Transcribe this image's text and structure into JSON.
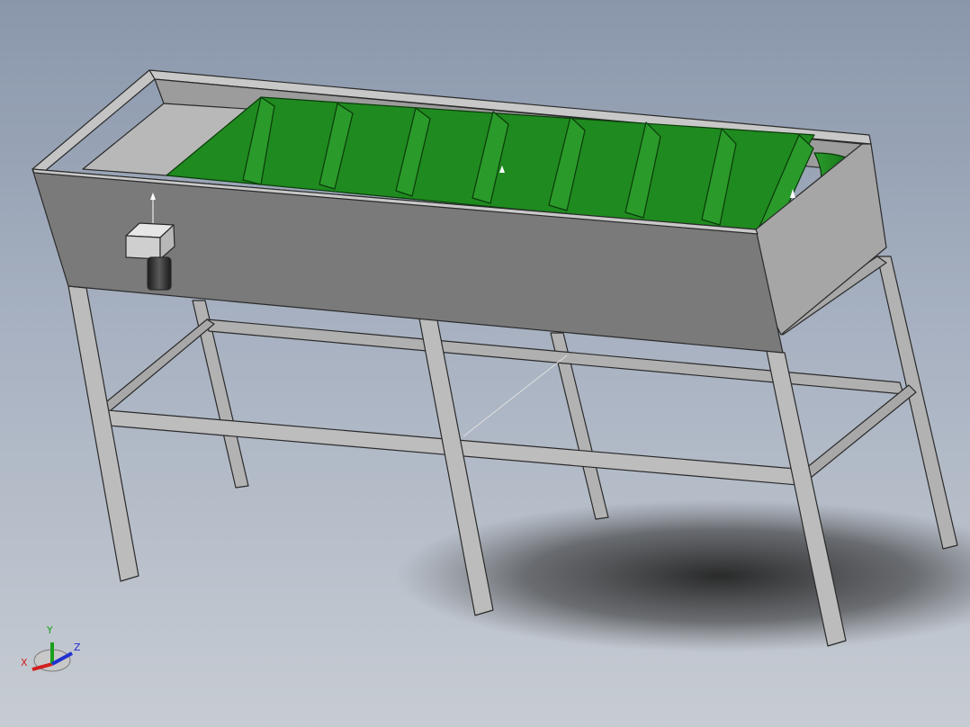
{
  "viewport": {
    "background_top": "#8a97ab",
    "background_bottom": "#c7ccd3"
  },
  "model": {
    "frame_color": "#b4b4b4",
    "frame_edge": "#2a2a2a",
    "belt_color": "#1f8a1f",
    "belt_dark": "#0f5f12",
    "hopper_front": "#7a7a7a",
    "hopper_inside": "#9a9a9a",
    "flight_count": 8
  },
  "triad": {
    "x_label": "X",
    "y_label": "Y",
    "z_label": "Z",
    "x_color": "#d21e1e",
    "y_color": "#1aa01a",
    "z_color": "#2030d0"
  }
}
